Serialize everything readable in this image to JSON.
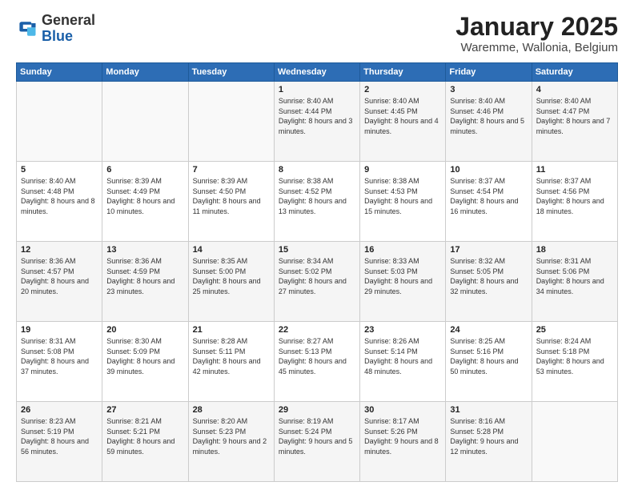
{
  "header": {
    "logo_general": "General",
    "logo_blue": "Blue",
    "title": "January 2025",
    "subtitle": "Waremme, Wallonia, Belgium"
  },
  "days_of_week": [
    "Sunday",
    "Monday",
    "Tuesday",
    "Wednesday",
    "Thursday",
    "Friday",
    "Saturday"
  ],
  "weeks": [
    [
      {
        "day": "",
        "info": ""
      },
      {
        "day": "",
        "info": ""
      },
      {
        "day": "",
        "info": ""
      },
      {
        "day": "1",
        "info": "Sunrise: 8:40 AM\nSunset: 4:44 PM\nDaylight: 8 hours\nand 3 minutes."
      },
      {
        "day": "2",
        "info": "Sunrise: 8:40 AM\nSunset: 4:45 PM\nDaylight: 8 hours\nand 4 minutes."
      },
      {
        "day": "3",
        "info": "Sunrise: 8:40 AM\nSunset: 4:46 PM\nDaylight: 8 hours\nand 5 minutes."
      },
      {
        "day": "4",
        "info": "Sunrise: 8:40 AM\nSunset: 4:47 PM\nDaylight: 8 hours\nand 7 minutes."
      }
    ],
    [
      {
        "day": "5",
        "info": "Sunrise: 8:40 AM\nSunset: 4:48 PM\nDaylight: 8 hours\nand 8 minutes."
      },
      {
        "day": "6",
        "info": "Sunrise: 8:39 AM\nSunset: 4:49 PM\nDaylight: 8 hours\nand 10 minutes."
      },
      {
        "day": "7",
        "info": "Sunrise: 8:39 AM\nSunset: 4:50 PM\nDaylight: 8 hours\nand 11 minutes."
      },
      {
        "day": "8",
        "info": "Sunrise: 8:38 AM\nSunset: 4:52 PM\nDaylight: 8 hours\nand 13 minutes."
      },
      {
        "day": "9",
        "info": "Sunrise: 8:38 AM\nSunset: 4:53 PM\nDaylight: 8 hours\nand 15 minutes."
      },
      {
        "day": "10",
        "info": "Sunrise: 8:37 AM\nSunset: 4:54 PM\nDaylight: 8 hours\nand 16 minutes."
      },
      {
        "day": "11",
        "info": "Sunrise: 8:37 AM\nSunset: 4:56 PM\nDaylight: 8 hours\nand 18 minutes."
      }
    ],
    [
      {
        "day": "12",
        "info": "Sunrise: 8:36 AM\nSunset: 4:57 PM\nDaylight: 8 hours\nand 20 minutes."
      },
      {
        "day": "13",
        "info": "Sunrise: 8:36 AM\nSunset: 4:59 PM\nDaylight: 8 hours\nand 23 minutes."
      },
      {
        "day": "14",
        "info": "Sunrise: 8:35 AM\nSunset: 5:00 PM\nDaylight: 8 hours\nand 25 minutes."
      },
      {
        "day": "15",
        "info": "Sunrise: 8:34 AM\nSunset: 5:02 PM\nDaylight: 8 hours\nand 27 minutes."
      },
      {
        "day": "16",
        "info": "Sunrise: 8:33 AM\nSunset: 5:03 PM\nDaylight: 8 hours\nand 29 minutes."
      },
      {
        "day": "17",
        "info": "Sunrise: 8:32 AM\nSunset: 5:05 PM\nDaylight: 8 hours\nand 32 minutes."
      },
      {
        "day": "18",
        "info": "Sunrise: 8:31 AM\nSunset: 5:06 PM\nDaylight: 8 hours\nand 34 minutes."
      }
    ],
    [
      {
        "day": "19",
        "info": "Sunrise: 8:31 AM\nSunset: 5:08 PM\nDaylight: 8 hours\nand 37 minutes."
      },
      {
        "day": "20",
        "info": "Sunrise: 8:30 AM\nSunset: 5:09 PM\nDaylight: 8 hours\nand 39 minutes."
      },
      {
        "day": "21",
        "info": "Sunrise: 8:28 AM\nSunset: 5:11 PM\nDaylight: 8 hours\nand 42 minutes."
      },
      {
        "day": "22",
        "info": "Sunrise: 8:27 AM\nSunset: 5:13 PM\nDaylight: 8 hours\nand 45 minutes."
      },
      {
        "day": "23",
        "info": "Sunrise: 8:26 AM\nSunset: 5:14 PM\nDaylight: 8 hours\nand 48 minutes."
      },
      {
        "day": "24",
        "info": "Sunrise: 8:25 AM\nSunset: 5:16 PM\nDaylight: 8 hours\nand 50 minutes."
      },
      {
        "day": "25",
        "info": "Sunrise: 8:24 AM\nSunset: 5:18 PM\nDaylight: 8 hours\nand 53 minutes."
      }
    ],
    [
      {
        "day": "26",
        "info": "Sunrise: 8:23 AM\nSunset: 5:19 PM\nDaylight: 8 hours\nand 56 minutes."
      },
      {
        "day": "27",
        "info": "Sunrise: 8:21 AM\nSunset: 5:21 PM\nDaylight: 8 hours\nand 59 minutes."
      },
      {
        "day": "28",
        "info": "Sunrise: 8:20 AM\nSunset: 5:23 PM\nDaylight: 9 hours\nand 2 minutes."
      },
      {
        "day": "29",
        "info": "Sunrise: 8:19 AM\nSunset: 5:24 PM\nDaylight: 9 hours\nand 5 minutes."
      },
      {
        "day": "30",
        "info": "Sunrise: 8:17 AM\nSunset: 5:26 PM\nDaylight: 9 hours\nand 8 minutes."
      },
      {
        "day": "31",
        "info": "Sunrise: 8:16 AM\nSunset: 5:28 PM\nDaylight: 9 hours\nand 12 minutes."
      },
      {
        "day": "",
        "info": ""
      }
    ]
  ]
}
